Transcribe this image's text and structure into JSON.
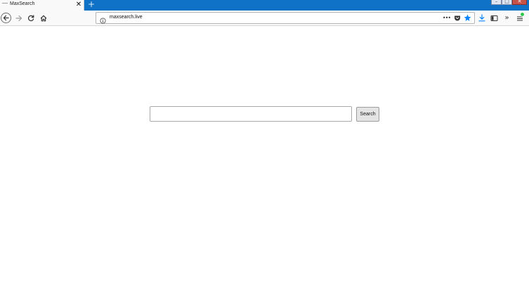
{
  "browser": {
    "tab": {
      "title": "MaxSearch",
      "close_icon": "close-icon"
    },
    "new_tab_glyph": "+",
    "window_controls": {
      "minimize": "–",
      "maximize": "□",
      "close": "✕"
    },
    "nav": {
      "back_icon": "back-arrow-icon",
      "forward_icon": "forward-arrow-icon",
      "reload_icon": "reload-icon",
      "home_icon": "home-icon"
    },
    "url": {
      "value": "maxsearch.live",
      "info_icon": "info-icon"
    },
    "page_actions": {
      "more": "•••",
      "pocket_icon": "pocket-icon",
      "bookmark_icon": "star-icon",
      "bookmark_color": "#0a84ff"
    },
    "toolbar": {
      "download_icon": "download-icon",
      "download_color": "#0a84ff",
      "sidebar_icon": "sidebar-icon",
      "overflow": "»",
      "menu_icon": "hamburger-menu-icon",
      "menu_badge_color": "#30c84a"
    }
  },
  "page": {
    "search": {
      "input_value": "",
      "placeholder": "",
      "button_label": "Search"
    }
  }
}
